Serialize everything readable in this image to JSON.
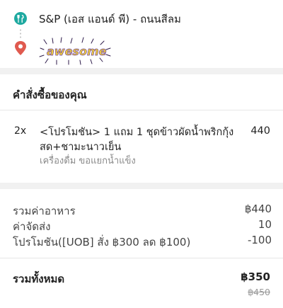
{
  "restaurant": {
    "name": "S&P (เอส แอนด์ พี) - ถนนสีลม",
    "icon": "fork-knife-icon",
    "icon_color": "#1ea9a0"
  },
  "destination": {
    "icon": "location-pin-icon",
    "icon_color": "#e05a4f",
    "sticker_text": "awesome"
  },
  "order": {
    "title": "คำสั่งซื้อของคุณ",
    "items": [
      {
        "qty": "2x",
        "name": "<โปรโมชัน> 1 แถม 1 ชุดข้าวผัดน้ำพริกกุ้งสด+ชามะนาวเย็น",
        "note": "เครื่องดื่ม ขอแยกน้ำแข็ง",
        "price": "440"
      }
    ]
  },
  "summary": {
    "rows": [
      {
        "label": "รวมค่าอาหาร",
        "value": "฿440"
      },
      {
        "label": "ค่าจัดส่ง",
        "value": "10"
      },
      {
        "label": "โปรโมชัน([UOB] สั่ง ฿300 ลด ฿100)",
        "value": "-100"
      }
    ],
    "total_label": "รวมทั้งหมด",
    "total_value": "฿350",
    "total_original": "฿450"
  }
}
